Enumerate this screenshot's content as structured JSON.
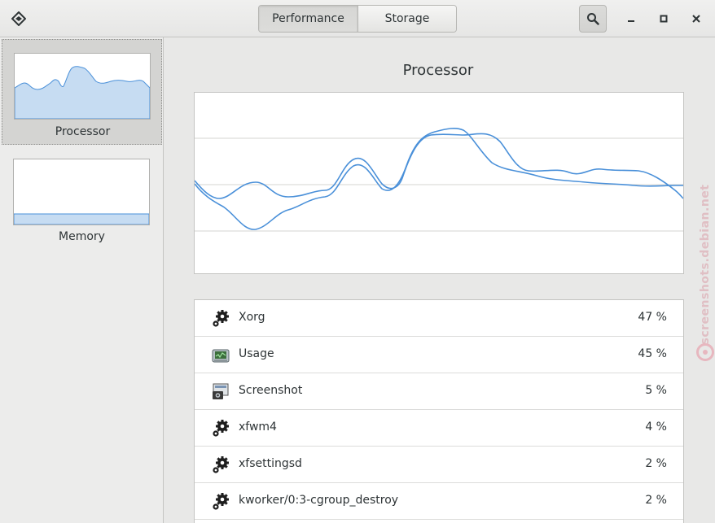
{
  "header": {
    "tabs": [
      {
        "label": "Performance",
        "active": true
      },
      {
        "label": "Storage",
        "active": false
      }
    ]
  },
  "sidebar": {
    "items": [
      {
        "label": "Processor",
        "selected": true
      },
      {
        "label": "Memory",
        "selected": false
      }
    ]
  },
  "main": {
    "title": "Processor",
    "processes": [
      {
        "name": "Xorg",
        "value": "47 %",
        "icon": "gears-icon"
      },
      {
        "name": "Usage",
        "value": "45 %",
        "icon": "system-monitor-icon"
      },
      {
        "name": "Screenshot",
        "value": "5 %",
        "icon": "screenshot-icon"
      },
      {
        "name": "xfwm4",
        "value": "4 %",
        "icon": "gears-icon"
      },
      {
        "name": "xfsettingsd",
        "value": "2 %",
        "icon": "gears-icon"
      },
      {
        "name": "kworker/0:3-cgroup_destroy",
        "value": "2 %",
        "icon": "gears-icon"
      }
    ]
  },
  "watermark": {
    "text": "screenshots.debian.net"
  },
  "colors": {
    "accent": "#4a90d9",
    "fill": "#c6dcf2"
  }
}
